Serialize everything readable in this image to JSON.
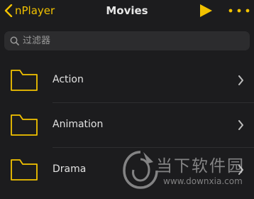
{
  "navbar": {
    "back_label": "nPlayer",
    "title": "Movies"
  },
  "search": {
    "placeholder": "过滤器"
  },
  "folders": [
    {
      "label": "Action"
    },
    {
      "label": "Animation"
    },
    {
      "label": "Drama"
    }
  ],
  "watermark": {
    "name": "当下软件园",
    "url": "www.downxia.com"
  },
  "colors": {
    "accent": "#f2c200",
    "background": "#1c1c1e",
    "search_bg": "#2c2c2e"
  }
}
